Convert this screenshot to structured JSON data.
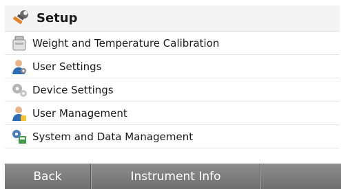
{
  "header": {
    "title": "Setup",
    "icon": "wrench-icon"
  },
  "menu": {
    "items": [
      {
        "label": "Weight and Temperature Calibration",
        "icon": "calibration-weight-icon"
      },
      {
        "label": "User Settings",
        "icon": "user-settings-icon"
      },
      {
        "label": "Device Settings",
        "icon": "gears-icon"
      },
      {
        "label": "User Management",
        "icon": "user-management-icon"
      },
      {
        "label": "System and Data Management",
        "icon": "system-data-icon"
      }
    ]
  },
  "footer": {
    "back_label": "Back",
    "info_label": "Instrument Info",
    "empty_label": ""
  },
  "colors": {
    "footer_bg": "#7f7f7f",
    "header_bg": "#f4f4f4",
    "accent_orange": "#e8822a",
    "accent_blue": "#2e6db5"
  }
}
